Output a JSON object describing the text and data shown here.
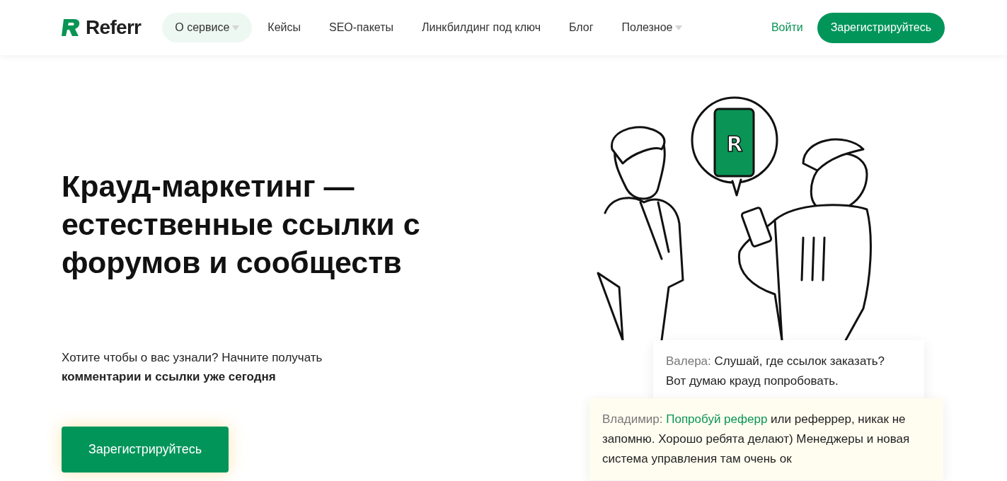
{
  "header": {
    "logo": "Referr",
    "nav": [
      {
        "label": "О сервисе",
        "selected": true,
        "dropdown": true
      },
      {
        "label": "Кейсы",
        "selected": false,
        "dropdown": false
      },
      {
        "label": "SEO-пакеты",
        "selected": false,
        "dropdown": false
      },
      {
        "label": "Линкбилдинг под ключ",
        "selected": false,
        "dropdown": false
      },
      {
        "label": "Блог",
        "selected": false,
        "dropdown": false
      },
      {
        "label": "Полезное",
        "selected": false,
        "dropdown": true
      }
    ],
    "login": "Войти",
    "register": "Зарегистрируйтесь"
  },
  "hero": {
    "title": "Крауд-маркетинг — естественные ссылки с форумов и сообществ",
    "subtitle": "Хотите чтобы о вас узнали? Начните получать **комментарии и ссылки уже сегодня**",
    "button": "Зарегистрируйтесь"
  },
  "illustration": {
    "phone_letter": "R"
  },
  "chat": [
    {
      "kind": "plain",
      "author": "Валера:",
      "text": "Слушай, где ссылок заказать? Вот думаю крауд попробовать."
    },
    {
      "kind": "highlighted",
      "author": "Владимир:",
      "link": "Попробуй реферр",
      "text": "или реферрер, никак не запомню. Хорошо ребята делают) Менеджеры и новая система управления там очень ок"
    }
  ]
}
